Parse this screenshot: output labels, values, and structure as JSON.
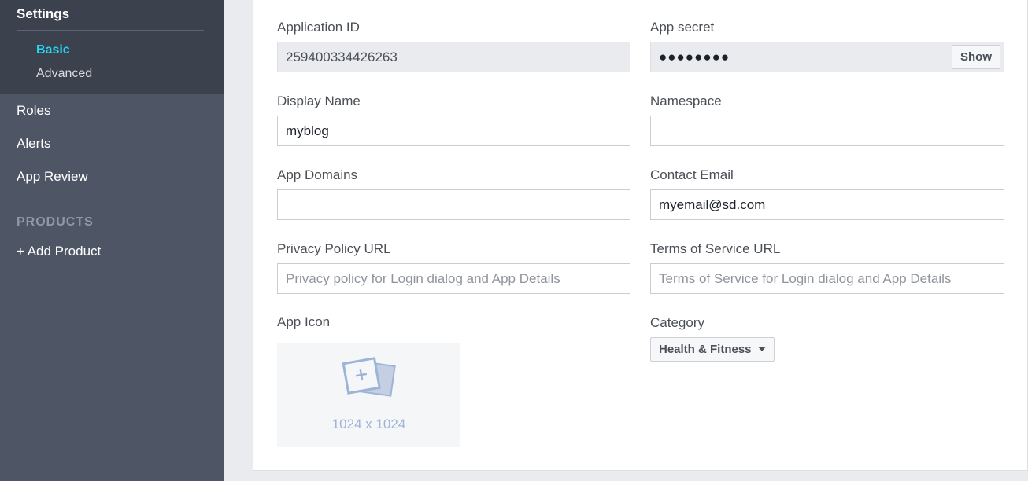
{
  "sidebar": {
    "settings_title": "Settings",
    "settings_items": [
      "Basic",
      "Advanced"
    ],
    "nav_items": [
      "Roles",
      "Alerts",
      "App Review"
    ],
    "products_label": "PRODUCTS",
    "add_product": "+ Add Product"
  },
  "form": {
    "application_id": {
      "label": "Application ID",
      "value": "259400334426263"
    },
    "app_secret": {
      "label": "App secret",
      "value": "●●●●●●●●",
      "show_button": "Show"
    },
    "display_name": {
      "label": "Display Name",
      "value": "myblog"
    },
    "namespace": {
      "label": "Namespace",
      "value": ""
    },
    "app_domains": {
      "label": "App Domains",
      "value": ""
    },
    "contact_email": {
      "label": "Contact Email",
      "value": "myemail@sd.com"
    },
    "privacy_policy_url": {
      "label": "Privacy Policy URL",
      "placeholder": "Privacy policy for Login dialog and App Details"
    },
    "terms_of_service_url": {
      "label": "Terms of Service URL",
      "placeholder": "Terms of Service for Login dialog and App Details"
    },
    "app_icon": {
      "label": "App Icon",
      "size_text": "1024 x 1024",
      "icon": "add-image-icon"
    },
    "category": {
      "label": "Category",
      "value": "Health & Fitness",
      "icon": "caret-down-icon"
    }
  },
  "colors": {
    "sidebar_bg": "#4e5665",
    "sidebar_active_bg": "#3b414d",
    "active_item": "#25d6f4",
    "page_bg": "#e9ebee"
  }
}
